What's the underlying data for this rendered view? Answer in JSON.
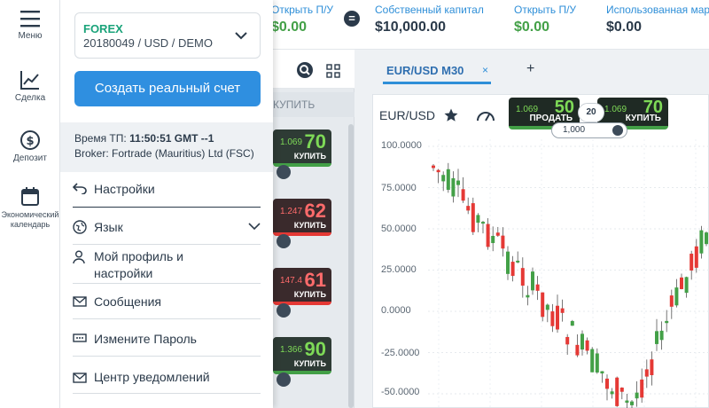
{
  "rail": {
    "items": [
      {
        "label": "Меню",
        "icon": "hamburger-icon"
      },
      {
        "label": "Сделка",
        "icon": "chart-line-icon"
      },
      {
        "label": "Депозит",
        "icon": "dollar-coin-icon"
      },
      {
        "label": "Экономический календарь",
        "icon": "calendar-icon"
      }
    ]
  },
  "topbar": {
    "stats": [
      {
        "label": "Открыть П/У",
        "value": "$0.00",
        "color": "green"
      },
      {
        "label": "Собственный капитал",
        "value": "$10,000.00",
        "color": "dark"
      },
      {
        "label": "Открыть П/У",
        "value": "$0.00",
        "color": "green"
      },
      {
        "label": "Использованная марж",
        "value": "$0.00",
        "color": "dark"
      }
    ],
    "equals_symbol": "="
  },
  "menu": {
    "account": {
      "type": "FOREX",
      "details": "20180049 / USD / DEMO"
    },
    "create_real_button": "Создать реальный счет",
    "server_time_label": "Время ТП:",
    "server_time_value": "11:50:51 GMT --1",
    "broker": "Broker: Fortrade (Mauritius) Ltd (FSC)",
    "items": [
      {
        "label": "Настройки",
        "icon": "undo-arrow-icon"
      },
      {
        "label": "Язык",
        "icon": "globe-icon"
      },
      {
        "label": "Мой профиль и настройки",
        "icon": "user-icon"
      },
      {
        "label": "Сообщения",
        "icon": "envelope-icon"
      },
      {
        "label": "Измените Пароль",
        "icon": "password-field-icon"
      },
      {
        "label": "Центр уведомлений",
        "icon": "envelope-icon"
      }
    ]
  },
  "instruments": {
    "subheader": "КУПИТЬ",
    "cards": [
      {
        "small": "1.069",
        "big": "70",
        "label": "КУПИТЬ",
        "color": "green"
      },
      {
        "small": "1.247",
        "big": "62",
        "label": "КУПИТЬ",
        "color": "red"
      },
      {
        "small": "147.4",
        "big": "61",
        "label": "КУПИТЬ",
        "color": "red"
      },
      {
        "small": "1.366",
        "big": "90",
        "label": "КУПИТЬ",
        "color": "green"
      }
    ]
  },
  "chart": {
    "tab_label": "EUR/USD M30",
    "tab_close": "×",
    "tab_add": "+",
    "title": "EUR/USD",
    "sell": {
      "small": "1.069",
      "big": "50",
      "label": "ПРОДАТЬ"
    },
    "buy": {
      "small": "1.069",
      "big": "70",
      "label": "КУПИТЬ"
    },
    "spread": "20",
    "quantity": "1,000",
    "y_labels": [
      "100.0000",
      "75.0000",
      "50.0000",
      "25.0000",
      "0.0000",
      "-25.0000",
      "-50.0000"
    ],
    "colors": {
      "up": "#43a047",
      "down": "#e53935"
    }
  }
}
